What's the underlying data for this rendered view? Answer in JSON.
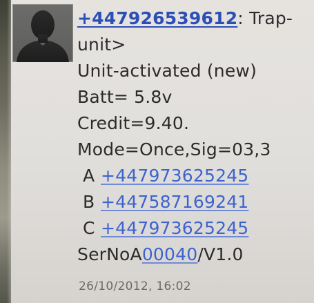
{
  "message": {
    "sender": {
      "number": "+447926539612",
      "rest_line1": ": Trap-",
      "rest_line2": "unit>"
    },
    "lines": [
      "Unit-activated (new)",
      "Batt= 5.8v",
      "Credit=9.40.",
      "Mode=Once,Sig=03,3"
    ],
    "contacts": [
      {
        "letter": "A",
        "number": "+447973625245"
      },
      {
        "letter": "B",
        "number": "+447587169241"
      },
      {
        "letter": "C",
        "number": "+447973625245"
      }
    ],
    "serial": {
      "prefix": "SerNoA",
      "link": "00040",
      "suffix": "/V1.0"
    },
    "timestamp": "26/10/2012, 16:02"
  },
  "avatar": {
    "icon": "person-silhouette-icon"
  },
  "colors": {
    "link": "#3d63cf",
    "sender_link": "#2c4fb6",
    "text": "#2b2b2b",
    "timestamp": "#6a6a6a",
    "background": "#e1dfdc"
  }
}
